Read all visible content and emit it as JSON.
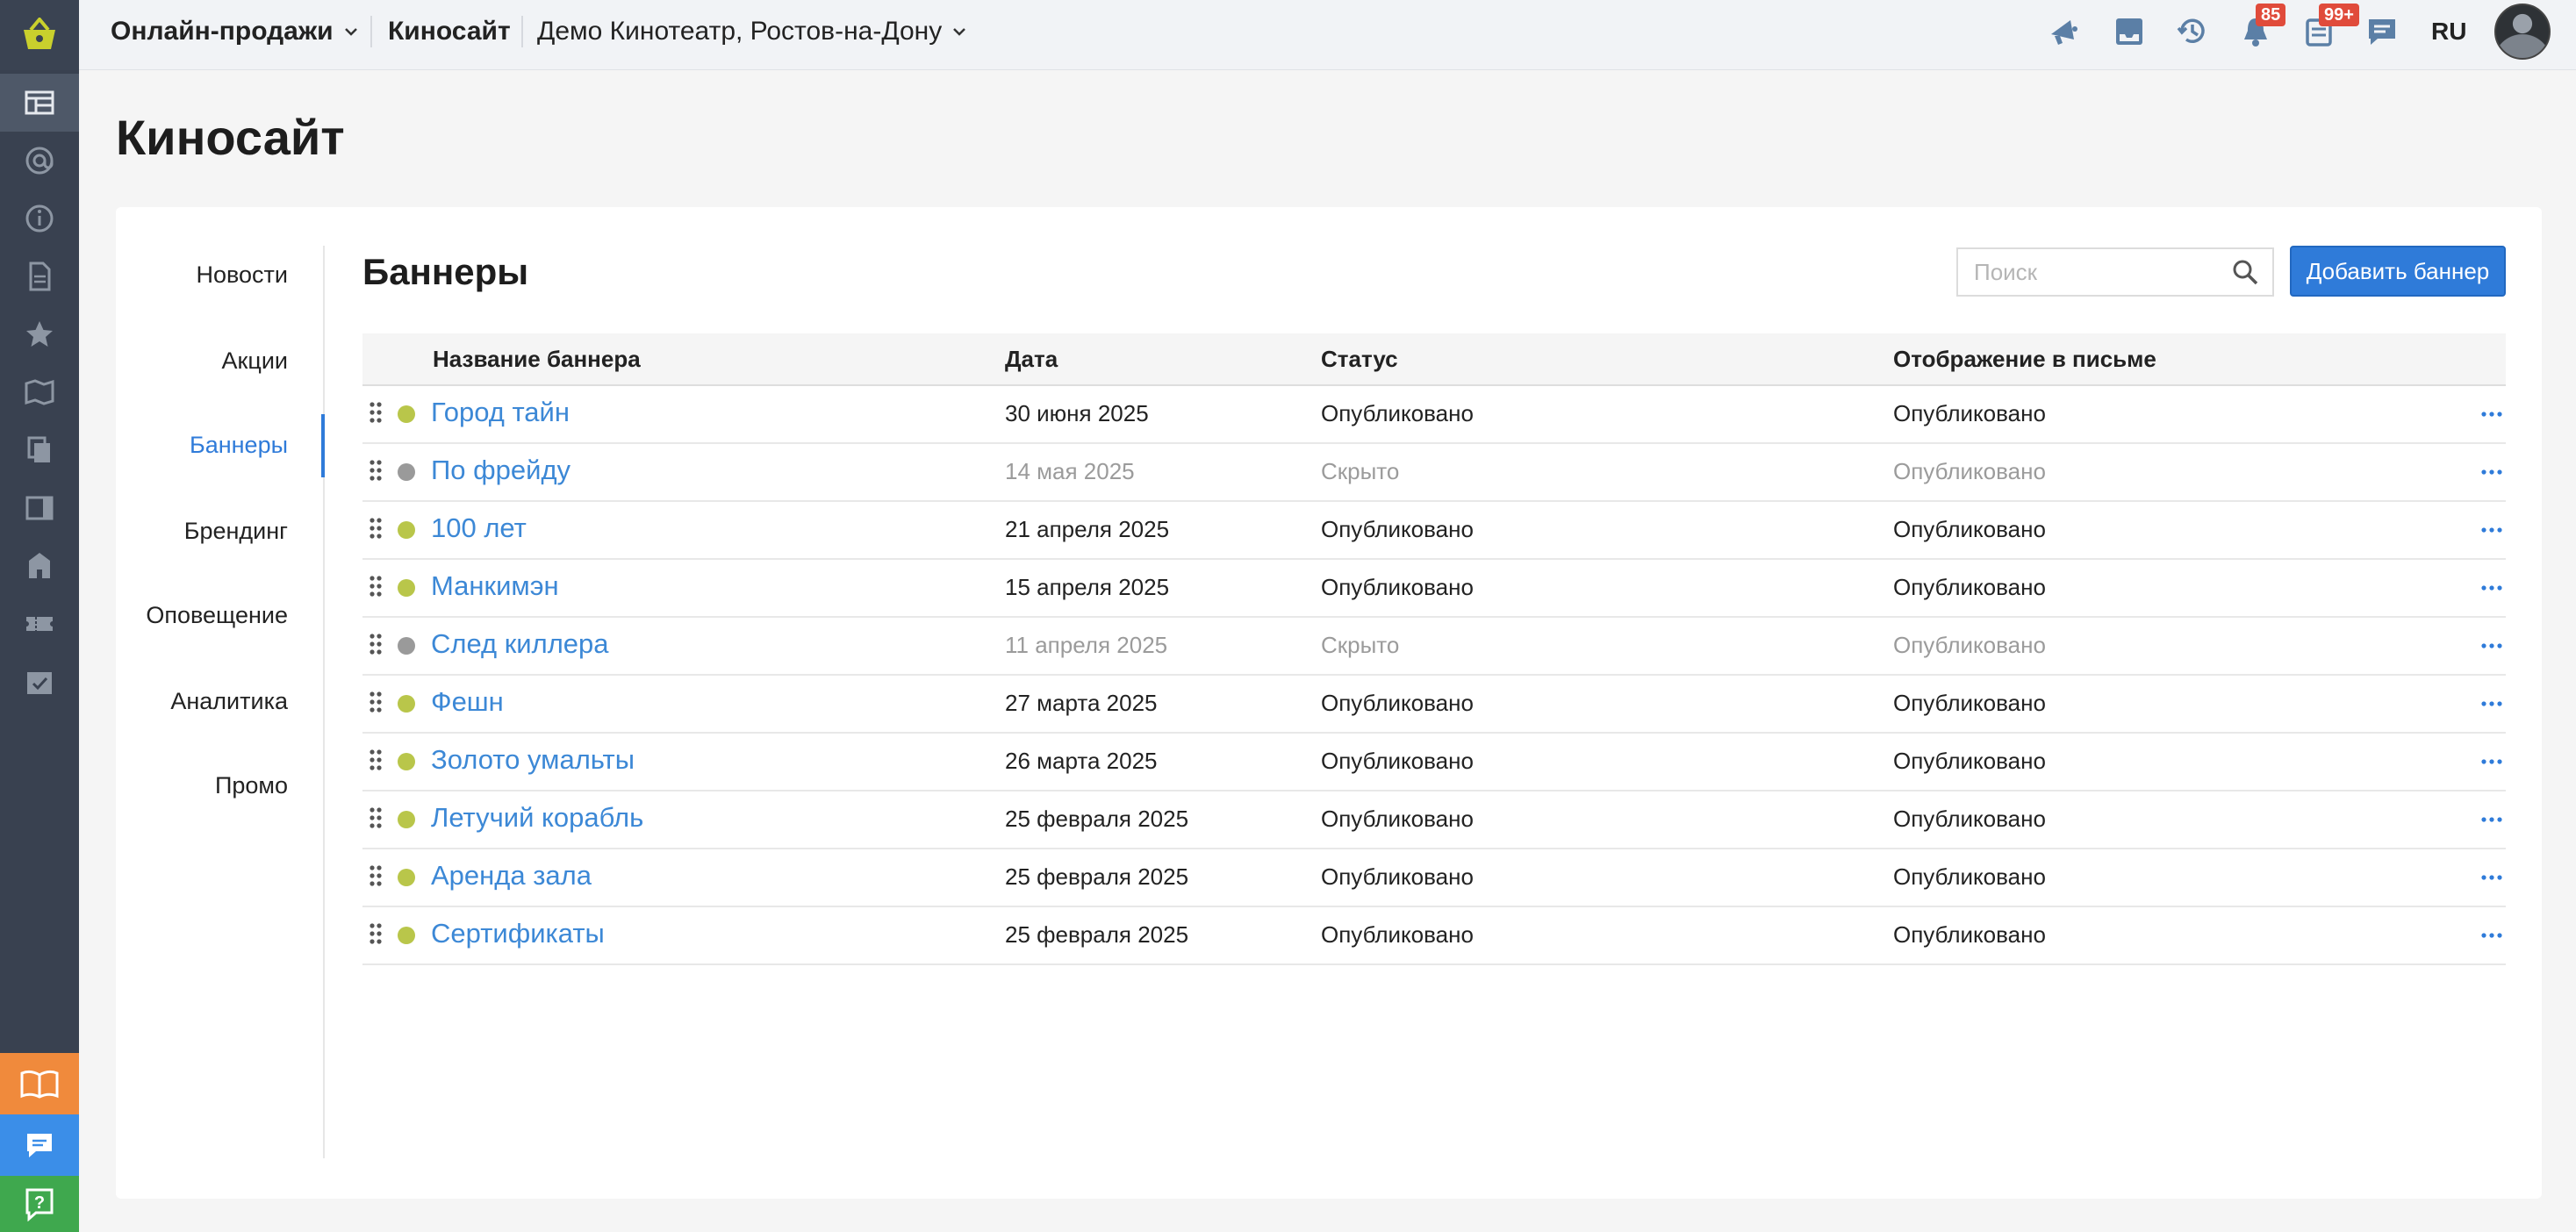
{
  "topbar": {
    "section": "Онлайн-продажи",
    "site": "Киносайт",
    "venue": "Демо Кинотеатр, Ростов-на-Дону",
    "badges": {
      "notifications": "85",
      "tasks": "99+"
    },
    "lang": "RU"
  },
  "page": {
    "title": "Киносайт"
  },
  "subnav": {
    "items": [
      {
        "label": "Новости"
      },
      {
        "label": "Акции"
      },
      {
        "label": "Баннеры",
        "active": true
      },
      {
        "label": "Брендинг"
      },
      {
        "label": "Оповещение"
      },
      {
        "label": "Аналитика"
      },
      {
        "label": "Промо"
      }
    ]
  },
  "section": {
    "title": "Баннеры",
    "search_placeholder": "Поиск",
    "add_label": "Добавить баннер"
  },
  "table": {
    "headers": [
      "Название баннера",
      "Дата",
      "Статус",
      "Отображение в письме"
    ],
    "rows": [
      {
        "name": "Город тайн",
        "date": "30 июня 2025",
        "status": "Опубликовано",
        "email": "Опубликовано",
        "state": "published"
      },
      {
        "name": "По фрейду",
        "date": "14 мая 2025",
        "status": "Скрыто",
        "email": "Опубликовано",
        "state": "hidden"
      },
      {
        "name": "100 лет",
        "date": "21 апреля 2025",
        "status": "Опубликовано",
        "email": "Опубликовано",
        "state": "published"
      },
      {
        "name": "Манкимэн",
        "date": "15 апреля 2025",
        "status": "Опубликовано",
        "email": "Опубликовано",
        "state": "published"
      },
      {
        "name": "След киллера",
        "date": "11 апреля 2025",
        "status": "Скрыто",
        "email": "Опубликовано",
        "state": "hidden"
      },
      {
        "name": "Фешн",
        "date": "27 марта 2025",
        "status": "Опубликовано",
        "email": "Опубликовано",
        "state": "published"
      },
      {
        "name": "Золото умальты",
        "date": "26 марта 2025",
        "status": "Опубликовано",
        "email": "Опубликовано",
        "state": "published"
      },
      {
        "name": "Летучий корабль",
        "date": "25 февраля 2025",
        "status": "Опубликовано",
        "email": "Опубликовано",
        "state": "published"
      },
      {
        "name": "Аренда зала",
        "date": "25 февраля 2025",
        "status": "Опубликовано",
        "email": "Опубликовано",
        "state": "published"
      },
      {
        "name": "Сертификаты",
        "date": "25 февраля 2025",
        "status": "Опубликовано",
        "email": "Опубликовано",
        "state": "published"
      }
    ]
  },
  "colors": {
    "accent": "#2f7bd9",
    "published_dot": "#b9c64a",
    "hidden_dot": "#9a9a9a",
    "sidebar": "#394150",
    "logo_yellow": "#c9d02d",
    "docs_orange": "#f08a3c",
    "chat_blue": "#3b8ee8",
    "help_green": "#3fa84e"
  },
  "icons": {
    "leftbar": [
      "basket-icon",
      "schedule-icon",
      "at-icon",
      "info-icon",
      "document-icon",
      "star-icon",
      "map-icon",
      "copy-icon",
      "panel-icon",
      "building-icon",
      "ticket-icon",
      "calendar-check-icon",
      "book-icon",
      "chat-icon",
      "help-icon"
    ],
    "topbar": [
      "megaphone-icon",
      "inbox-icon",
      "history-icon",
      "bell-icon",
      "clipboard-icon",
      "message-icon"
    ]
  }
}
